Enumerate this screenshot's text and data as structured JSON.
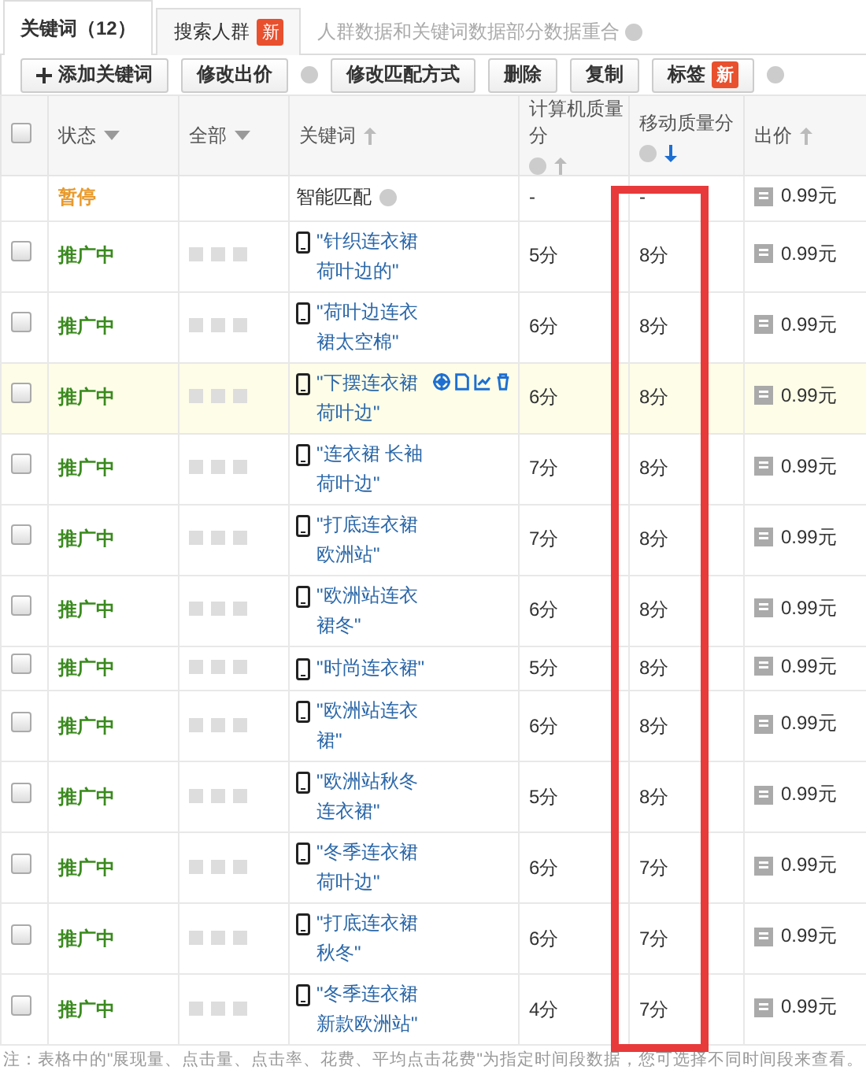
{
  "tabs": [
    {
      "label": "关键词（12）",
      "selected": true
    },
    {
      "label": "搜索人群",
      "badge": "新",
      "selected": false
    }
  ],
  "tab_note": "人群数据和关键词数据部分数据重合",
  "toolbar": [
    {
      "label": "添加关键词",
      "kind": "add",
      "help": false
    },
    {
      "label": "修改出价",
      "kind": "plain",
      "help": true
    },
    {
      "label": "修改匹配方式",
      "kind": "plain",
      "help": false
    },
    {
      "label": "删除",
      "kind": "plain",
      "help": false
    },
    {
      "label": "复制",
      "kind": "plain",
      "help": false
    },
    {
      "label": "标签",
      "kind": "plain",
      "badge": "新",
      "help": true
    }
  ],
  "header_checked": false,
  "highlight_frame": true,
  "columns": [
    {
      "label": "状态",
      "kind": "dropdown",
      "help": false
    },
    {
      "label": "全部",
      "kind": "dropdown",
      "help": false
    },
    {
      "label": "关键词",
      "kind": "sort",
      "help": false,
      "sorted": false
    },
    {
      "label": "计算机质量分",
      "kind": "sort",
      "help": true,
      "sorted": false
    },
    {
      "label": "移动质量分",
      "kind": "sort",
      "help": true,
      "sorted": true
    },
    {
      "label": "出价",
      "kind": "sort",
      "help": false,
      "sorted": false
    }
  ],
  "rows": [
    {
      "kind": "smart",
      "status": "暂停",
      "paused": true,
      "keyword": "智能匹配",
      "pc_score": "-",
      "mobile_score": "-",
      "price": "0.99元",
      "hovered": false
    },
    {
      "kind": "keyword",
      "checked": false,
      "status": "推广中",
      "paused": false,
      "keyword": "\"针织连衣裙荷叶边的\"",
      "pc_score": "5分",
      "mobile_score": "8分",
      "price": "0.99元",
      "hovered": false
    },
    {
      "kind": "keyword",
      "checked": false,
      "status": "推广中",
      "paused": false,
      "keyword": "\"荷叶边连衣裙太空棉\"",
      "pc_score": "6分",
      "mobile_score": "8分",
      "price": "0.99元",
      "hovered": false
    },
    {
      "kind": "keyword",
      "checked": false,
      "status": "推广中",
      "paused": false,
      "keyword": "\"下摆连衣裙荷叶边\"",
      "pc_score": "6分",
      "mobile_score": "8分",
      "price": "0.99元",
      "hovered": true
    },
    {
      "kind": "keyword",
      "checked": false,
      "status": "推广中",
      "paused": false,
      "keyword": "\"连衣裙 长袖荷叶边\"",
      "pc_score": "7分",
      "mobile_score": "8分",
      "price": "0.99元",
      "hovered": false
    },
    {
      "kind": "keyword",
      "checked": false,
      "status": "推广中",
      "paused": false,
      "keyword": "\"打底连衣裙欧洲站\"",
      "pc_score": "7分",
      "mobile_score": "8分",
      "price": "0.99元",
      "hovered": false
    },
    {
      "kind": "keyword",
      "checked": false,
      "status": "推广中",
      "paused": false,
      "keyword": "\"欧洲站连衣裙冬\"",
      "pc_score": "6分",
      "mobile_score": "8分",
      "price": "0.99元",
      "hovered": false
    },
    {
      "kind": "keyword",
      "checked": false,
      "status": "推广中",
      "paused": false,
      "keyword": "\"时尚连衣裙\"",
      "pc_score": "5分",
      "mobile_score": "8分",
      "price": "0.99元",
      "hovered": false
    },
    {
      "kind": "keyword",
      "checked": false,
      "status": "推广中",
      "paused": false,
      "keyword": "\"欧洲站连衣裙\"",
      "pc_score": "6分",
      "mobile_score": "8分",
      "price": "0.99元",
      "hovered": false
    },
    {
      "kind": "keyword",
      "checked": false,
      "status": "推广中",
      "paused": false,
      "keyword": "\"欧洲站秋冬连衣裙\"",
      "pc_score": "5分",
      "mobile_score": "8分",
      "price": "0.99元",
      "hovered": false
    },
    {
      "kind": "keyword",
      "checked": false,
      "status": "推广中",
      "paused": false,
      "keyword": "\"冬季连衣裙荷叶边\"",
      "pc_score": "6分",
      "mobile_score": "7分",
      "price": "0.99元",
      "hovered": false
    },
    {
      "kind": "keyword",
      "checked": false,
      "status": "推广中",
      "paused": false,
      "keyword": "\"打底连衣裙秋冬\"",
      "pc_score": "6分",
      "mobile_score": "7分",
      "price": "0.99元",
      "hovered": false
    },
    {
      "kind": "keyword",
      "checked": false,
      "status": "推广中",
      "paused": false,
      "keyword": "\"冬季连衣裙新款欧洲站\"",
      "pc_score": "4分",
      "mobile_score": "7分",
      "price": "0.99元",
      "hovered": false
    }
  ],
  "footnote": "注：表格中的\"展现量、点击量、点击率、花费、平均点击花费\"为指定时间段数据，您可选择不同时间段来查看。"
}
